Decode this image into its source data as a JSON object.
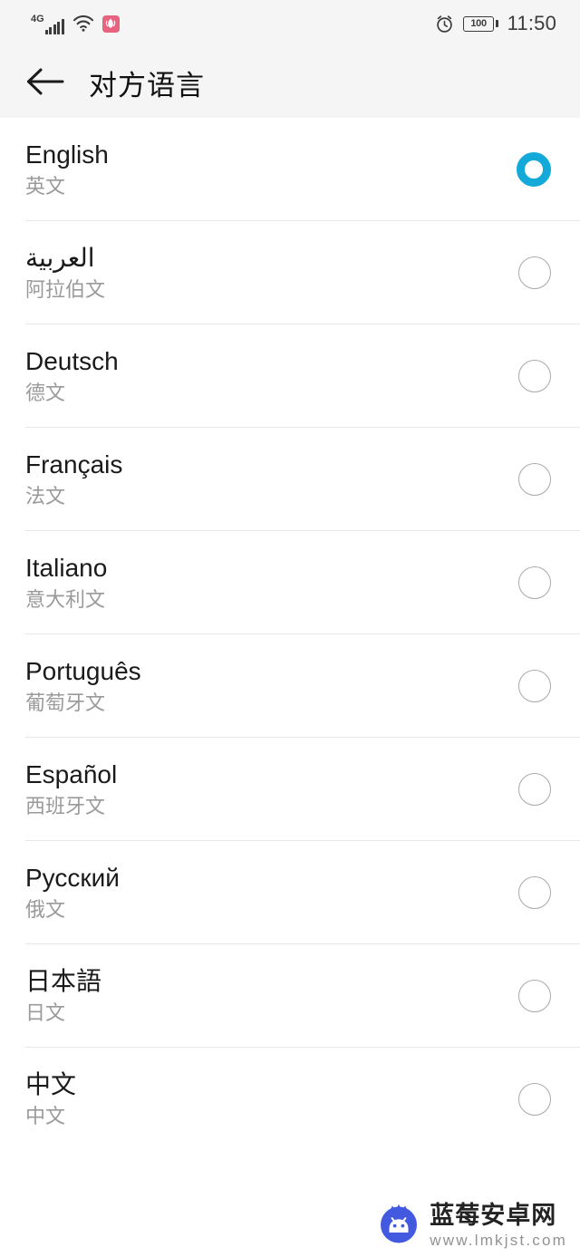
{
  "status_bar": {
    "network_type": "4G",
    "signal_icon": "signal-bars-icon",
    "wifi_icon": "wifi-icon",
    "app_badge_icon": "huawei-app-icon",
    "app_badge_color": "#e8637f",
    "alarm_icon": "alarm-clock-icon",
    "battery_percent": "100",
    "time": "11:50"
  },
  "app_bar": {
    "back_icon": "back-arrow-icon",
    "title": "对方语言"
  },
  "theme": {
    "accent": "#13a9d8",
    "header_bg": "#f5f5f5",
    "content_bg": "#ffffff",
    "divider": "#e8e8e8",
    "primary_text": "#1a1a1a",
    "secondary_text": "#9a9a9a"
  },
  "languages": [
    {
      "name": "English",
      "sub": "英文",
      "selected": true,
      "rtl": false
    },
    {
      "name": "العربية",
      "sub": "阿拉伯文",
      "selected": false,
      "rtl": true
    },
    {
      "name": "Deutsch",
      "sub": "德文",
      "selected": false,
      "rtl": false
    },
    {
      "name": "Français",
      "sub": "法文",
      "selected": false,
      "rtl": false
    },
    {
      "name": "Italiano",
      "sub": "意大利文",
      "selected": false,
      "rtl": false
    },
    {
      "name": "Português",
      "sub": "葡萄牙文",
      "selected": false,
      "rtl": false
    },
    {
      "name": "Español",
      "sub": "西班牙文",
      "selected": false,
      "rtl": false
    },
    {
      "name": "Русский",
      "sub": "俄文",
      "selected": false,
      "rtl": false
    },
    {
      "name": "日本語",
      "sub": "日文",
      "selected": false,
      "rtl": false
    },
    {
      "name": "中文",
      "sub": "中文",
      "selected": false,
      "rtl": false
    }
  ],
  "watermark": {
    "logo_icon": "blueberry-android-logo-icon",
    "title": "蓝莓安卓网",
    "url": "www.lmkjst.com",
    "logo_color": "#3d55e0"
  }
}
